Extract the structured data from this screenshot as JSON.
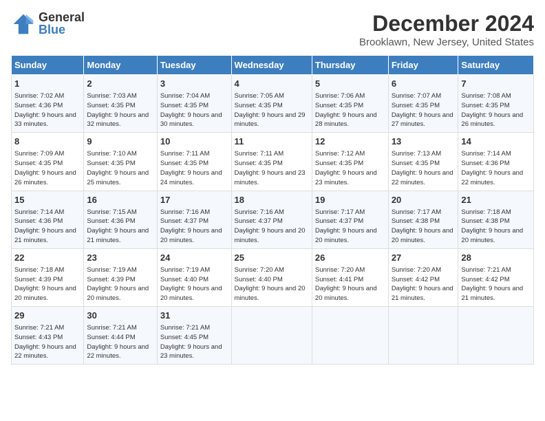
{
  "header": {
    "logo_line1": "General",
    "logo_line2": "Blue",
    "title": "December 2024",
    "subtitle": "Brooklawn, New Jersey, United States"
  },
  "columns": [
    "Sunday",
    "Monday",
    "Tuesday",
    "Wednesday",
    "Thursday",
    "Friday",
    "Saturday"
  ],
  "weeks": [
    [
      {
        "day": "1",
        "sunrise": "Sunrise: 7:02 AM",
        "sunset": "Sunset: 4:36 PM",
        "daylight": "Daylight: 9 hours and 33 minutes."
      },
      {
        "day": "2",
        "sunrise": "Sunrise: 7:03 AM",
        "sunset": "Sunset: 4:35 PM",
        "daylight": "Daylight: 9 hours and 32 minutes."
      },
      {
        "day": "3",
        "sunrise": "Sunrise: 7:04 AM",
        "sunset": "Sunset: 4:35 PM",
        "daylight": "Daylight: 9 hours and 30 minutes."
      },
      {
        "day": "4",
        "sunrise": "Sunrise: 7:05 AM",
        "sunset": "Sunset: 4:35 PM",
        "daylight": "Daylight: 9 hours and 29 minutes."
      },
      {
        "day": "5",
        "sunrise": "Sunrise: 7:06 AM",
        "sunset": "Sunset: 4:35 PM",
        "daylight": "Daylight: 9 hours and 28 minutes."
      },
      {
        "day": "6",
        "sunrise": "Sunrise: 7:07 AM",
        "sunset": "Sunset: 4:35 PM",
        "daylight": "Daylight: 9 hours and 27 minutes."
      },
      {
        "day": "7",
        "sunrise": "Sunrise: 7:08 AM",
        "sunset": "Sunset: 4:35 PM",
        "daylight": "Daylight: 9 hours and 26 minutes."
      }
    ],
    [
      {
        "day": "8",
        "sunrise": "Sunrise: 7:09 AM",
        "sunset": "Sunset: 4:35 PM",
        "daylight": "Daylight: 9 hours and 26 minutes."
      },
      {
        "day": "9",
        "sunrise": "Sunrise: 7:10 AM",
        "sunset": "Sunset: 4:35 PM",
        "daylight": "Daylight: 9 hours and 25 minutes."
      },
      {
        "day": "10",
        "sunrise": "Sunrise: 7:11 AM",
        "sunset": "Sunset: 4:35 PM",
        "daylight": "Daylight: 9 hours and 24 minutes."
      },
      {
        "day": "11",
        "sunrise": "Sunrise: 7:11 AM",
        "sunset": "Sunset: 4:35 PM",
        "daylight": "Daylight: 9 hours and 23 minutes."
      },
      {
        "day": "12",
        "sunrise": "Sunrise: 7:12 AM",
        "sunset": "Sunset: 4:35 PM",
        "daylight": "Daylight: 9 hours and 23 minutes."
      },
      {
        "day": "13",
        "sunrise": "Sunrise: 7:13 AM",
        "sunset": "Sunset: 4:35 PM",
        "daylight": "Daylight: 9 hours and 22 minutes."
      },
      {
        "day": "14",
        "sunrise": "Sunrise: 7:14 AM",
        "sunset": "Sunset: 4:36 PM",
        "daylight": "Daylight: 9 hours and 22 minutes."
      }
    ],
    [
      {
        "day": "15",
        "sunrise": "Sunrise: 7:14 AM",
        "sunset": "Sunset: 4:36 PM",
        "daylight": "Daylight: 9 hours and 21 minutes."
      },
      {
        "day": "16",
        "sunrise": "Sunrise: 7:15 AM",
        "sunset": "Sunset: 4:36 PM",
        "daylight": "Daylight: 9 hours and 21 minutes."
      },
      {
        "day": "17",
        "sunrise": "Sunrise: 7:16 AM",
        "sunset": "Sunset: 4:37 PM",
        "daylight": "Daylight: 9 hours and 20 minutes."
      },
      {
        "day": "18",
        "sunrise": "Sunrise: 7:16 AM",
        "sunset": "Sunset: 4:37 PM",
        "daylight": "Daylight: 9 hours and 20 minutes."
      },
      {
        "day": "19",
        "sunrise": "Sunrise: 7:17 AM",
        "sunset": "Sunset: 4:37 PM",
        "daylight": "Daylight: 9 hours and 20 minutes."
      },
      {
        "day": "20",
        "sunrise": "Sunrise: 7:17 AM",
        "sunset": "Sunset: 4:38 PM",
        "daylight": "Daylight: 9 hours and 20 minutes."
      },
      {
        "day": "21",
        "sunrise": "Sunrise: 7:18 AM",
        "sunset": "Sunset: 4:38 PM",
        "daylight": "Daylight: 9 hours and 20 minutes."
      }
    ],
    [
      {
        "day": "22",
        "sunrise": "Sunrise: 7:18 AM",
        "sunset": "Sunset: 4:39 PM",
        "daylight": "Daylight: 9 hours and 20 minutes."
      },
      {
        "day": "23",
        "sunrise": "Sunrise: 7:19 AM",
        "sunset": "Sunset: 4:39 PM",
        "daylight": "Daylight: 9 hours and 20 minutes."
      },
      {
        "day": "24",
        "sunrise": "Sunrise: 7:19 AM",
        "sunset": "Sunset: 4:40 PM",
        "daylight": "Daylight: 9 hours and 20 minutes."
      },
      {
        "day": "25",
        "sunrise": "Sunrise: 7:20 AM",
        "sunset": "Sunset: 4:40 PM",
        "daylight": "Daylight: 9 hours and 20 minutes."
      },
      {
        "day": "26",
        "sunrise": "Sunrise: 7:20 AM",
        "sunset": "Sunset: 4:41 PM",
        "daylight": "Daylight: 9 hours and 20 minutes."
      },
      {
        "day": "27",
        "sunrise": "Sunrise: 7:20 AM",
        "sunset": "Sunset: 4:42 PM",
        "daylight": "Daylight: 9 hours and 21 minutes."
      },
      {
        "day": "28",
        "sunrise": "Sunrise: 7:21 AM",
        "sunset": "Sunset: 4:42 PM",
        "daylight": "Daylight: 9 hours and 21 minutes."
      }
    ],
    [
      {
        "day": "29",
        "sunrise": "Sunrise: 7:21 AM",
        "sunset": "Sunset: 4:43 PM",
        "daylight": "Daylight: 9 hours and 22 minutes."
      },
      {
        "day": "30",
        "sunrise": "Sunrise: 7:21 AM",
        "sunset": "Sunset: 4:44 PM",
        "daylight": "Daylight: 9 hours and 22 minutes."
      },
      {
        "day": "31",
        "sunrise": "Sunrise: 7:21 AM",
        "sunset": "Sunset: 4:45 PM",
        "daylight": "Daylight: 9 hours and 23 minutes."
      },
      null,
      null,
      null,
      null
    ]
  ]
}
